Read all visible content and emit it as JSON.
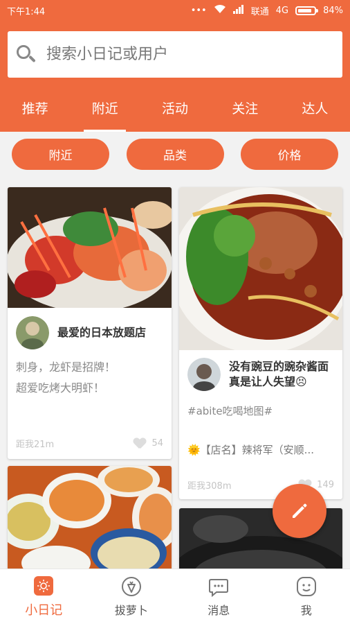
{
  "status_bar": {
    "time": "下午1:44",
    "carrier": "联通",
    "network": "4G",
    "battery": "84%"
  },
  "search": {
    "placeholder": "搜索小日记或用户"
  },
  "tabs": [
    {
      "label": "推荐",
      "active": false
    },
    {
      "label": "附近",
      "active": true
    },
    {
      "label": "活动",
      "active": false
    },
    {
      "label": "关注",
      "active": false
    },
    {
      "label": "达人",
      "active": false
    }
  ],
  "filters": [
    {
      "label": "附近"
    },
    {
      "label": "品类"
    },
    {
      "label": "价格"
    }
  ],
  "cards": [
    {
      "title": "最爱的日本放题店",
      "desc_lines": [
        "刺身，龙虾是招牌！",
        "超爱吃烤大明虾！"
      ],
      "distance": "距我21m",
      "likes": "54"
    },
    {
      "title_lines": [
        "没有豌豆的豌杂酱面",
        "真是让人失望😣"
      ],
      "tag": "#abite吃喝地图#",
      "shop": "🌞【店名】辣将军（安顺...",
      "distance": "距我308m",
      "likes": "149"
    }
  ],
  "bottom_nav": [
    {
      "label": "小日记",
      "icon": "diary-icon",
      "active": true
    },
    {
      "label": "拔萝卜",
      "icon": "radish-icon",
      "active": false
    },
    {
      "label": "消息",
      "icon": "message-icon",
      "active": false
    },
    {
      "label": "我",
      "icon": "profile-icon",
      "active": false
    }
  ],
  "colors": {
    "accent": "#ef6a3e",
    "background": "#f2f2f2"
  }
}
